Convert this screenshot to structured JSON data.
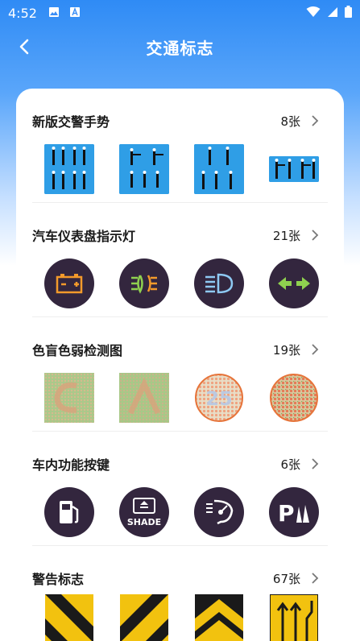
{
  "status": {
    "time": "4:52"
  },
  "nav": {
    "title": "交通标志"
  },
  "sections": [
    {
      "title": "新版交警手势",
      "count": "8张"
    },
    {
      "title": "汽车仪表盘指示灯",
      "count": "21张"
    },
    {
      "title": "色盲色弱检测图",
      "count": "19张"
    },
    {
      "title": "车内功能按键",
      "count": "6张"
    },
    {
      "title": "警告标志",
      "count": "67张"
    }
  ],
  "labels": {
    "shade": "SHADE",
    "parking": "P"
  },
  "colors": {
    "primary": "#2f8bf5",
    "icon_bg": "#33263e",
    "warning_yellow": "#f2c20f"
  }
}
